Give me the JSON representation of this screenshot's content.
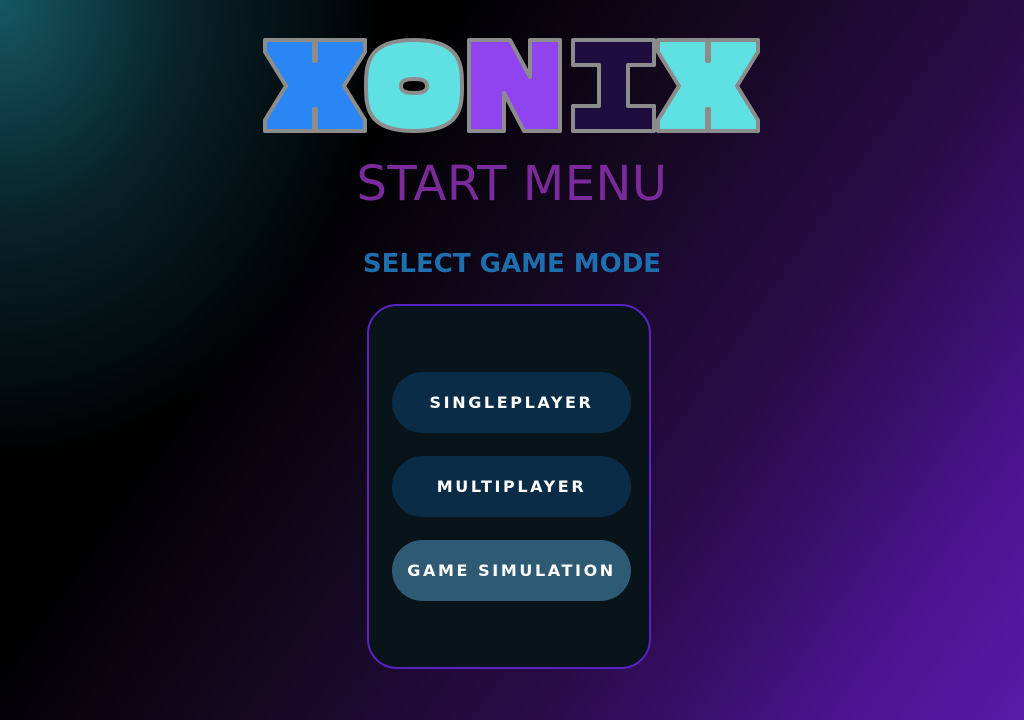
{
  "logo": {
    "text": "XONIX",
    "letters": [
      {
        "char": "X",
        "color": "#2b86f5"
      },
      {
        "char": "O",
        "color": "#5fe1e4"
      },
      {
        "char": "N",
        "color": "#8f44f0"
      },
      {
        "char": "I",
        "color": "#1e0d3f"
      },
      {
        "char": "X",
        "color": "#5fe1e4"
      }
    ],
    "outline_color": "#8c8c8c"
  },
  "menu": {
    "title": "START MENU",
    "subtitle": "SELECT GAME MODE"
  },
  "modes": [
    {
      "label": "SINGLEPLAYER",
      "active": false
    },
    {
      "label": "MULTIPLAYER",
      "active": false
    },
    {
      "label": "GAME SIMULATION",
      "active": true
    }
  ],
  "colors": {
    "title": "#7b2a9c",
    "subtitle": "#1d6fae",
    "panel_border": "#5a22c4",
    "button": "#0b2c47",
    "button_active": "#2f5a73"
  }
}
